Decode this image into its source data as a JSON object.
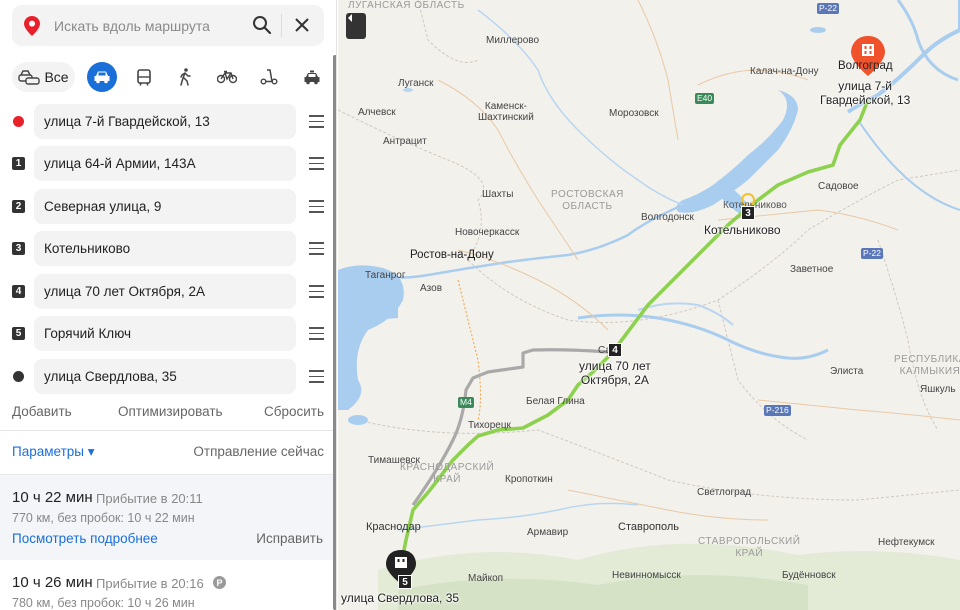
{
  "search": {
    "placeholder": "Искать вдоль маршрута"
  },
  "modes": {
    "all_label": "Все"
  },
  "colors": {
    "accent": "#1a6fd8",
    "route": "#8dd14f",
    "alt_route": "#a9a9a9",
    "start": "#e8202a",
    "finish": "#333333",
    "pin": "#f0532b"
  },
  "waypoints": [
    {
      "marker": "",
      "label": "улица 7-й Гвардейской, 13"
    },
    {
      "marker": "1",
      "label": "улица 64-й Армии, 143А"
    },
    {
      "marker": "2",
      "label": "Северная улица, 9"
    },
    {
      "marker": "3",
      "label": "Котельниково"
    },
    {
      "marker": "4",
      "label": "улица 70 лет Октября, 2А"
    },
    {
      "marker": "5",
      "label": "Горячий Ключ"
    },
    {
      "marker": "",
      "label": "улица Свердлова, 35"
    }
  ],
  "actions": {
    "add": "Добавить",
    "optimize": "Оптимизировать",
    "reset": "Сбросить"
  },
  "params": {
    "label": "Параметры ▾",
    "departure": "Отправление сейчас"
  },
  "routes": [
    {
      "duration": "10 ч 22 мин",
      "arrival": "Прибытие в 20:11",
      "distance": "770 км, без пробок: 10 ч 22 мин",
      "details": "Посмотреть подробнее",
      "fix": "Исправить"
    },
    {
      "duration": "10 ч 26 мин",
      "arrival": "Прибытие в 20:16",
      "paid_badge": "P",
      "distance": "780 км, без пробок: 10 ч 26 мин"
    }
  ],
  "map": {
    "labels": {
      "luganskaya": "ЛУГАНСКАЯ\nОБЛАСТЬ",
      "millerovo": "Миллерово",
      "lugansk": "Луганск",
      "alchevsk": "Алчевск",
      "kamensk": "Каменск-\nШахтинский",
      "antratsit": "Антрацит",
      "kalach": "Калач-на-Дону",
      "volgograd": "Волгоград",
      "morozovsk": "Морозовск",
      "shakhty": "Шахты",
      "rostov_obl": "РОСТОВСКАЯ\nОБЛАСТЬ",
      "sadovoe": "Садовое",
      "volgodonsk": "Волгодонск",
      "novocherkassk": "Новочеркасск",
      "rostov": "Ростов-на-Дону",
      "taganrog": "Таганрог",
      "azov": "Азов",
      "zavetnoe": "Заветное",
      "respublika": "РЕСПУБЛИКА\nКАЛМЫКИЯ",
      "elista": "Элиста",
      "yashkul": "Яшкуль",
      "belaya_glina": "Белая Глина",
      "tikhoretsk": "Тихорецк",
      "timashevsk": "Тимашевск",
      "krasnodar_krai": "КРАСНОДАРСКИЙ\nКРАЙ",
      "kropotkin": "Кропоткин",
      "svetlograd": "Светлоград",
      "krasnodar": "Краснодар",
      "armavir": "Армавир",
      "stavropol": "Ставрополь",
      "stavropol_krai": "СТАВРОПОЛЬСКИЙ\nКРАЙ",
      "neftekumsk": "Нефтекумск",
      "maykop": "Майкоп",
      "nevinnomyssk": "Невинномысск",
      "budennovsk": "Будённовск",
      "sal": "Сал",
      "kotelnikovo_small": "Котельниково"
    },
    "roads": {
      "r22a": "Р-22",
      "e40": "Е40",
      "r22b": "Р-22",
      "r216": "Р-216",
      "m4": "М4"
    },
    "waypoint_labels": {
      "start": "улица 7-й\nГвардейской, 13",
      "kotelnikovo": "Котельниково",
      "kotelnikovo_num": "3",
      "okt": "улица 70 лет\nОктября, 2А",
      "okt_num": "4",
      "end": "улица Свердлова, 35",
      "end_num": "5"
    }
  }
}
